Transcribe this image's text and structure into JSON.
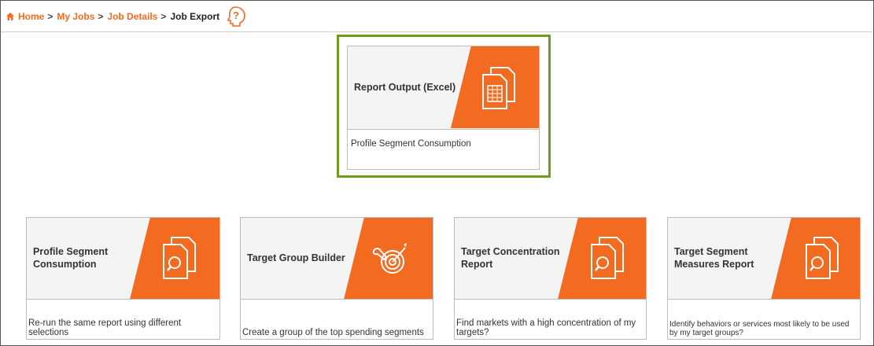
{
  "breadcrumb": {
    "items": [
      "Home",
      "My Jobs",
      "Job Details"
    ],
    "separator": ">",
    "current": "Job Export"
  },
  "icons": {
    "home": "home-icon",
    "help": "help-question-icon",
    "document": "document-spreadsheet-icon",
    "magnifier": "document-search-icon",
    "target": "target-wrench-icon"
  },
  "colors": {
    "accent": "#f26b21",
    "link": "#f26b21",
    "highlight": "#6f9e18",
    "card_bg": "#f4f4f4"
  },
  "featured": {
    "title": "Report Output (Excel)",
    "description": "Profile Segment Consumption"
  },
  "cards": [
    {
      "title": "Profile Segment Consumption",
      "description": "Re-run the same report using different selections",
      "icon": "document-search-icon"
    },
    {
      "title": "Target Group Builder",
      "description": "Create a group of the top spending segments",
      "icon": "target-wrench-icon"
    },
    {
      "title": "Target Concentration Report",
      "description": "Find markets with a high concentration of my targets?",
      "icon": "document-search-icon"
    },
    {
      "title": "Target Segment Measures Report",
      "description": "Identify behaviors or services most likely to be used by my target groups?",
      "icon": "document-search-icon"
    }
  ]
}
